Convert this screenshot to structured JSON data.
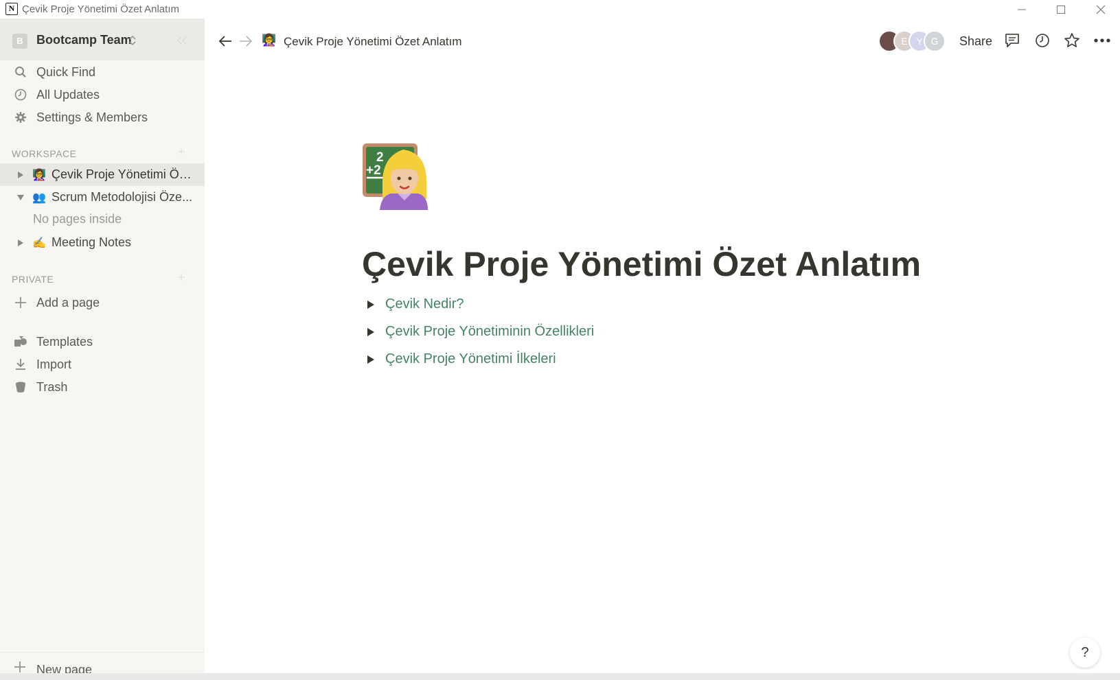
{
  "window": {
    "app_logo": "N",
    "title": "Çevik Proje Yönetimi Özet Anlatım"
  },
  "sidebar": {
    "workspace": {
      "badge": "B",
      "name": "Bootcamp Team"
    },
    "nav": [
      {
        "label": "Quick Find",
        "icon": "search-icon"
      },
      {
        "label": "All Updates",
        "icon": "clock-icon"
      },
      {
        "label": "Settings & Members",
        "icon": "gear-icon"
      }
    ],
    "workspace_label": "WORKSPACE",
    "pages": [
      {
        "emoji": "👩‍🏫",
        "label": "Çevik Proje Yönetimi Öz...",
        "expanded": false,
        "active": true
      },
      {
        "emoji": "👥",
        "label": "Scrum Metodolojisi Öze...",
        "expanded": true,
        "active": false
      },
      {
        "emoji": "✍️",
        "label": "Meeting Notes",
        "expanded": false,
        "active": false
      }
    ],
    "no_pages_inside": "No pages inside",
    "private_label": "PRIVATE",
    "add_page": "Add a page",
    "bottom_nav": [
      {
        "label": "Templates",
        "icon": "templates-icon"
      },
      {
        "label": "Import",
        "icon": "import-icon"
      },
      {
        "label": "Trash",
        "icon": "trash-icon"
      }
    ],
    "new_page": "New page"
  },
  "topbar": {
    "breadcrumb_emoji": "👩‍🏫",
    "breadcrumb_title": "Çevik Proje Yönetimi Özet Anlatım",
    "avatars": [
      {
        "initial": "",
        "color": "#6b4e4a"
      },
      {
        "initial": "E",
        "color": "#dcd0cd"
      },
      {
        "initial": "Y",
        "color": "#d3d6ee"
      },
      {
        "initial": "G",
        "color": "#cfd4d6"
      }
    ],
    "share": "Share"
  },
  "page": {
    "title": "Çevik Proje Yönetimi Özet Anlatım",
    "icon": "teacher-emoji",
    "toggles": [
      "Çevik Nedir?",
      "Çevik Proje Yönetiminin Özellikleri",
      "Çevik Proje Yönetimi İlkeleri"
    ],
    "link_color": "#448361"
  },
  "help": "?"
}
